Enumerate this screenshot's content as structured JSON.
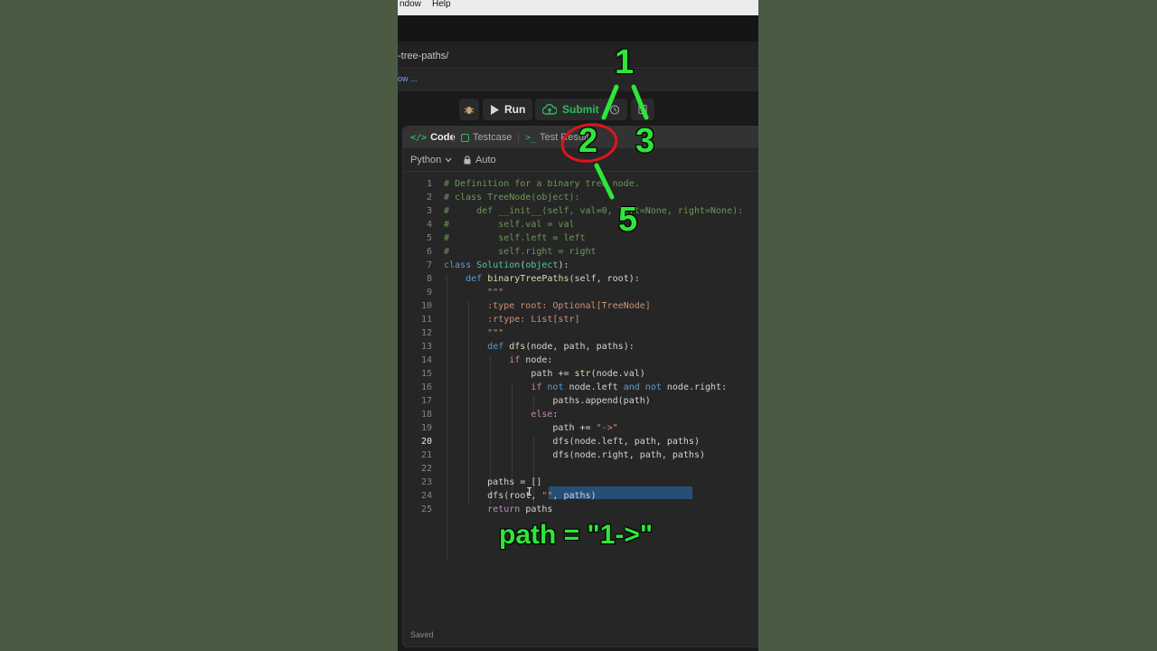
{
  "menubar": {
    "window": "ndow",
    "help": "Help"
  },
  "browser": {
    "url": "-tree-paths/",
    "bookmark": "ow ..."
  },
  "toolbar": {
    "run_label": "Run",
    "submit_label": "Submit"
  },
  "tabs": [
    {
      "label": "Code",
      "icon": "code-icon"
    },
    {
      "label": "Testcase",
      "icon": "checkbox-icon"
    },
    {
      "label": "Test Result",
      "icon": "terminal-icon"
    }
  ],
  "editor": {
    "language": "Python",
    "mode": "Auto",
    "active_line": 20,
    "status": "Saved"
  },
  "colors": {
    "comment": "#6a9955",
    "keyword": "#569cd6",
    "control": "#c586c0",
    "function": "#dcdcaa",
    "class": "#4ec9b0",
    "param": "#9cdcfe",
    "docstring": "#ce9178",
    "selection": "#264f78",
    "annotation_green": "#2ee63a",
    "annotation_red": "#e0141e"
  },
  "code_lines": [
    "# Definition for a binary tree node.",
    "# class TreeNode(object):",
    "#     def __init__(self, val=0, left=None, right=None):",
    "#         self.val = val",
    "#         self.left = left",
    "#         self.right = right",
    "class Solution(object):",
    "    def binaryTreePaths(self, root):",
    "        \"\"\"",
    "        :type root: Optional[TreeNode]",
    "        :rtype: List[str]",
    "        \"\"\"",
    "        def dfs(node, path, paths):",
    "            if node:",
    "                path += str(node.val)",
    "                if not node.left and not node.right:",
    "                    paths.append(path)",
    "                else:",
    "                    path += \"->\"",
    "                    dfs(node.left, path, paths)",
    "                    dfs(node.right, path, paths)",
    "",
    "        paths = []",
    "        dfs(root, \"\", paths)",
    "        return paths"
  ],
  "tree_annotation": {
    "nodes": [
      "1",
      "2",
      "3",
      "5"
    ]
  },
  "path_annotation": "path = \"1->\""
}
